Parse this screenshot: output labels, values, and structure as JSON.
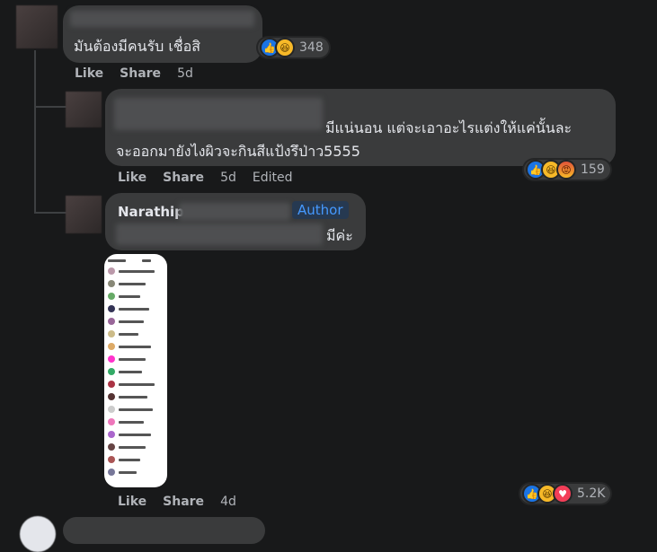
{
  "comment1": {
    "text": "มันต้องมีคนรับ เชื่อสิ",
    "like_label": "Like",
    "share_label": "Share",
    "time": "5d",
    "reaction_count": "348"
  },
  "reply1": {
    "text_line1": "มีแน่นอน แต่จะเอาอะไรแต่งให้แค่นั้นละ",
    "text_line2": "จะออกมายังไงผิวจะกินสีแป้งรึป่าว5555",
    "like_label": "Like",
    "share_label": "Share",
    "time": "5d",
    "edited_label": "Edited",
    "reaction_count": "159"
  },
  "reply2": {
    "author_name": "Narathip",
    "author_badge": "Author",
    "text": "มีค่ะ",
    "like_label": "Like",
    "share_label": "Share",
    "time": "4d",
    "reaction_count": "5.2K"
  },
  "icons": {
    "like": "like-reaction-icon",
    "haha": "haha-reaction-icon",
    "angry": "angry-reaction-icon",
    "love": "love-reaction-icon"
  },
  "colors": {
    "background": "#18191a",
    "bubble": "#3a3b3c",
    "text": "#e4e6eb",
    "secondary_text": "#b0b3b8",
    "author_badge_text": "#4599ff",
    "like_blue": "#1b74e4"
  }
}
